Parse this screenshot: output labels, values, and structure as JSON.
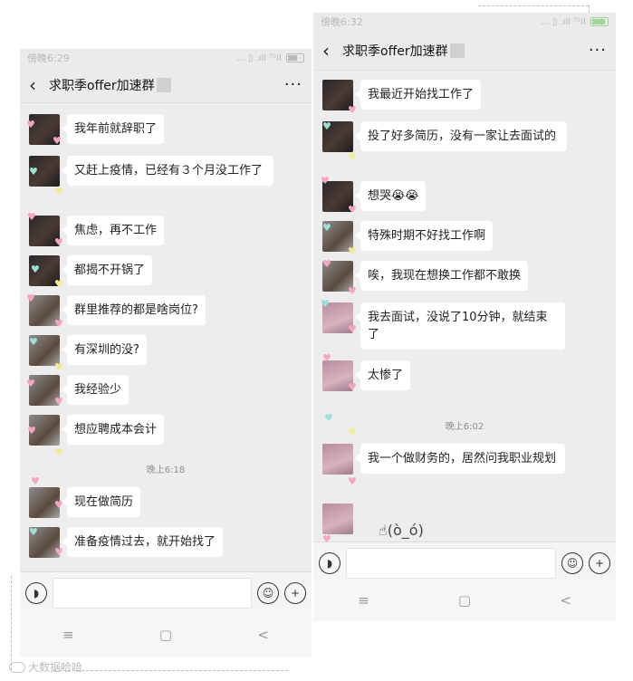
{
  "left_phone": {
    "status": {
      "time": "傍晚6:29",
      "signal_text": "... ▯ .ıll ᵀᵇll"
    },
    "header": {
      "title": "求职季offer加速群"
    },
    "messages": [
      {
        "text": "我年前就辞职了"
      },
      {
        "text": "又赶上疫情，已经有３个月没工作了"
      },
      {
        "text": "焦虑，再不工作"
      },
      {
        "text": "都揭不开锅了"
      },
      {
        "text": "群里推荐的都是啥岗位?"
      },
      {
        "text": "有深圳的没?"
      },
      {
        "text": "我经验少"
      },
      {
        "text": "想应聘成本会计"
      },
      {
        "text": "现在做简历"
      },
      {
        "text": "准备疫情过去，就开始找了"
      }
    ],
    "timestamp": "晚上6:18",
    "icons": {
      "back": "chevron-left-icon",
      "more": "more-icon",
      "voice": "voice-icon",
      "emoji": "emoji-icon",
      "add": "plus-icon"
    },
    "navbar": {
      "menu": "≡",
      "home": "▢",
      "back": "<"
    }
  },
  "right_phone": {
    "status": {
      "time": "傍晚6:32",
      "signal_text": "... ▯ .ıll ᵀᵇll"
    },
    "header": {
      "title": "求职季offer加速群"
    },
    "messages": [
      {
        "text": "我最近开始找工作了"
      },
      {
        "text": "投了好多简历，没有一家让去面试的"
      },
      {
        "text": "想哭😭😭"
      },
      {
        "text": "特殊时期不好找工作啊"
      },
      {
        "text": "唉，我现在想换工作都不敢换"
      },
      {
        "text": "我去面试，没说了10分钟，就结束了"
      },
      {
        "text": "太惨了"
      },
      {
        "text": "我一个做财务的，居然问我职业规划"
      }
    ],
    "timestamp": "晚上6:02",
    "sticker": "☝(ò_ó)",
    "navbar": {
      "menu": "≡",
      "home": "▢",
      "back": "<"
    }
  },
  "watermark": {
    "text": "大数据哈哈"
  }
}
